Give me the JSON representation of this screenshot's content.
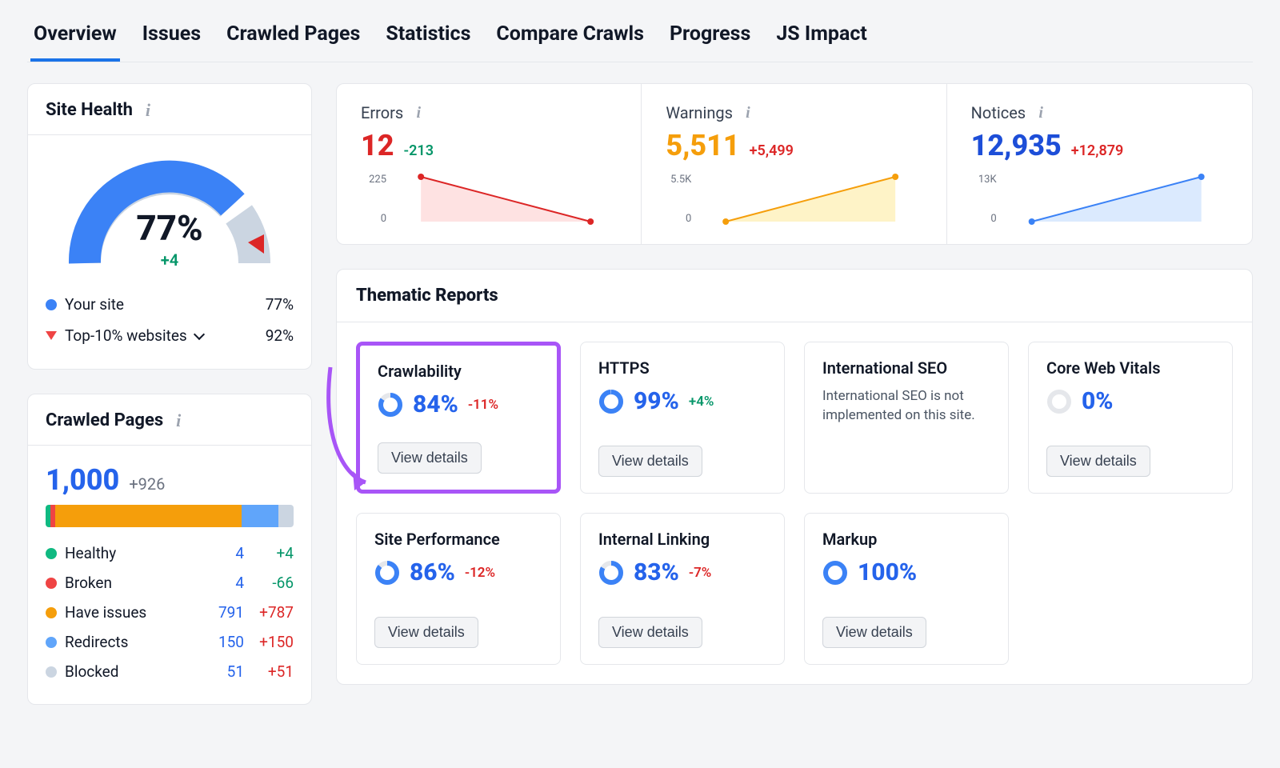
{
  "tabs": [
    "Overview",
    "Issues",
    "Crawled Pages",
    "Statistics",
    "Compare Crawls",
    "Progress",
    "JS Impact"
  ],
  "active_tab_index": 0,
  "site_health": {
    "title": "Site Health",
    "percent": "77%",
    "delta": "+4",
    "legend": {
      "your_site_label": "Your site",
      "your_site_pct": "77%",
      "top10_label": "Top-10% websites",
      "top10_pct": "92%"
    }
  },
  "crawled_pages": {
    "title": "Crawled Pages",
    "total": "1,000",
    "total_delta": "+926",
    "rows": [
      {
        "label": "Healthy",
        "value": "4",
        "delta": "+4",
        "color": "green",
        "delta_sign": "pos"
      },
      {
        "label": "Broken",
        "value": "4",
        "delta": "-66",
        "color": "red",
        "delta_sign": "pos"
      },
      {
        "label": "Have issues",
        "value": "791",
        "delta": "+787",
        "color": "orange",
        "delta_sign": "neg"
      },
      {
        "label": "Redirects",
        "value": "150",
        "delta": "+150",
        "color": "lblue",
        "delta_sign": "neg"
      },
      {
        "label": "Blocked",
        "value": "51",
        "delta": "+51",
        "color": "grey",
        "delta_sign": "neg"
      }
    ]
  },
  "summary": {
    "errors": {
      "label": "Errors",
      "value": "12",
      "delta": "-213",
      "ymax": "225",
      "ymin": "0"
    },
    "warnings": {
      "label": "Warnings",
      "value": "5,511",
      "delta": "+5,499",
      "ymax": "5.5K",
      "ymin": "0"
    },
    "notices": {
      "label": "Notices",
      "value": "12,935",
      "delta": "+12,879",
      "ymax": "13K",
      "ymin": "0"
    }
  },
  "thematic": {
    "title": "Thematic Reports",
    "view_details_label": "View details",
    "reports": [
      {
        "name": "Crawlability",
        "pct": "84%",
        "delta": "-11%",
        "ring": 84,
        "delta_sign": "neg",
        "highlight": true
      },
      {
        "name": "HTTPS",
        "pct": "99%",
        "delta": "+4%",
        "ring": 99,
        "delta_sign": "pos"
      },
      {
        "name": "International SEO",
        "msg": "International SEO is not implemented on this site."
      },
      {
        "name": "Core Web Vitals",
        "pct": "0%",
        "delta": "",
        "ring": 0
      },
      {
        "name": "Site Performance",
        "pct": "86%",
        "delta": "-12%",
        "ring": 86,
        "delta_sign": "neg"
      },
      {
        "name": "Internal Linking",
        "pct": "83%",
        "delta": "-7%",
        "ring": 83,
        "delta_sign": "neg"
      },
      {
        "name": "Markup",
        "pct": "100%",
        "delta": "",
        "ring": 100
      }
    ]
  },
  "chart_data": [
    {
      "type": "area",
      "name": "Errors trend",
      "x": [
        0,
        1
      ],
      "values": [
        225,
        12
      ],
      "ylim": [
        0,
        225
      ],
      "color": "#dc2626",
      "fill": "#fecaca"
    },
    {
      "type": "area",
      "name": "Warnings trend",
      "x": [
        0,
        1
      ],
      "values": [
        12,
        5511
      ],
      "ylim": [
        0,
        5500
      ],
      "color": "#f59e0b",
      "fill": "#fde68a"
    },
    {
      "type": "area",
      "name": "Notices trend",
      "x": [
        0,
        1
      ],
      "values": [
        56,
        12935
      ],
      "ylim": [
        0,
        13000
      ],
      "color": "#3b82f6",
      "fill": "#bfdbfe"
    }
  ]
}
